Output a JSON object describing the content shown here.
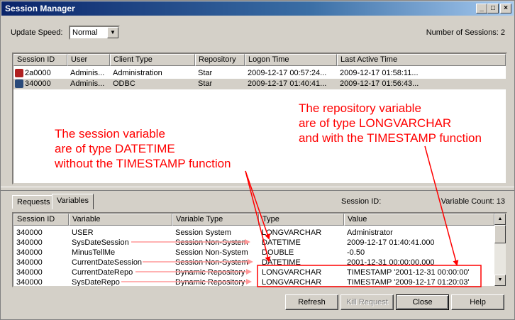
{
  "window": {
    "title": "Session Manager",
    "minimize": "_",
    "maximize": "□",
    "close": "×"
  },
  "top": {
    "update_speed_label": "Update Speed:",
    "update_speed_value": "Normal",
    "session_count": "Number of Sessions: 2"
  },
  "sessions": {
    "columns": [
      "Session ID",
      "User",
      "Client Type",
      "Repository",
      "Logon Time",
      "Last Active Time"
    ],
    "rows": [
      [
        "2a0000",
        "Adminis...",
        "Administration",
        "Star",
        "2009-12-17 00:57:24...",
        "2009-12-17 01:58:11..."
      ],
      [
        "340000",
        "Adminis...",
        "ODBC",
        "Star",
        "2009-12-17 01:40:41...",
        "2009-12-17 01:56:43..."
      ]
    ]
  },
  "tabs": {
    "requests": "Requests",
    "variables": "Variables"
  },
  "vars_header": {
    "session_id": "Session ID:",
    "variable_count": "Variable Count: 13"
  },
  "variables": {
    "columns": [
      "Session ID",
      "Variable",
      "Variable Type",
      "Type",
      "Value"
    ],
    "rows": [
      [
        "340000",
        "USER",
        "Session System",
        "LONGVARCHAR",
        "Administrator"
      ],
      [
        "340000",
        "SysDateSession",
        "Session Non-System",
        "DATETIME",
        "2009-12-17 01:40:41.000"
      ],
      [
        "340000",
        "MinusTellMe",
        "Session Non-System",
        "DOUBLE",
        "-0.50"
      ],
      [
        "340000",
        "CurrentDateSession",
        "Session Non-System",
        "DATETIME",
        "2001-12-31 00:00:00.000"
      ],
      [
        "340000",
        "CurrentDateRepo",
        "Dynamic Repository",
        "LONGVARCHAR",
        "TIMESTAMP '2001-12-31 00:00:00'"
      ],
      [
        "340000",
        "SysDateRepo",
        "Dynamic Repository",
        "LONGVARCHAR",
        "TIMESTAMP '2009-12-17 01:20:03'"
      ]
    ]
  },
  "buttons": {
    "refresh": "Refresh",
    "kill": "Kill Request",
    "close": "Close",
    "help": "Help"
  },
  "annotations": {
    "repo": [
      "The repository variable",
      "are of type LONGVARCHAR",
      "and with the TIMESTAMP function"
    ],
    "session": [
      "The session variable",
      "are of type DATETIME",
      "without the TIMESTAMP function"
    ]
  },
  "colors": {
    "annotation": "#ff0000",
    "title_bar": "#0a246a",
    "arrow_pink": "#ff9999"
  }
}
